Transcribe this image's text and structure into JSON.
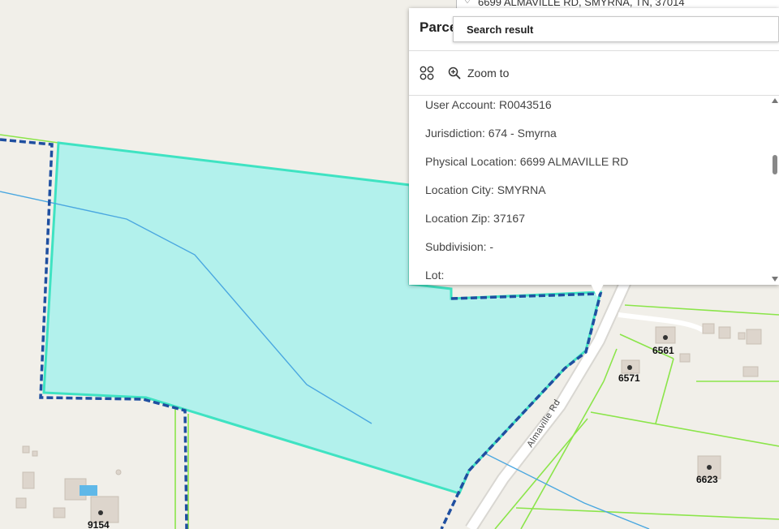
{
  "map": {
    "road_label": "Almaville Rd",
    "address_labels": [
      "6561",
      "6571",
      "6623",
      "9154"
    ],
    "colors": {
      "background": "#f1efe9",
      "parcel_fill": "#b2f1ec",
      "parcel_stroke": "#3fe3c2",
      "parcel_line": "#8be54a",
      "dashed_boundary": "#1f4fa0",
      "water_line": "#4aa7e0",
      "road": "#ffffff",
      "building": "#ddd5cc"
    }
  },
  "search_top": {
    "pin_icon": "location-pin-icon",
    "text": "6699 ALMAVILLE RD, SMYRNA, TN, 37014"
  },
  "popup": {
    "title": "Parcel",
    "search_result_label": "Search result",
    "actions": {
      "zoom_to_label": "Zoom to",
      "grid_icon": "grid-icon",
      "zoom_icon": "zoom-in-icon"
    },
    "attributes": [
      "User Account: R0043516",
      "Jurisdiction: 674 - Smyrna",
      "Physical Location: 6699 ALMAVILLE RD",
      "Location City: SMYRNA",
      "Location Zip: 37167",
      "Subdivision: -",
      "Lot:"
    ]
  }
}
